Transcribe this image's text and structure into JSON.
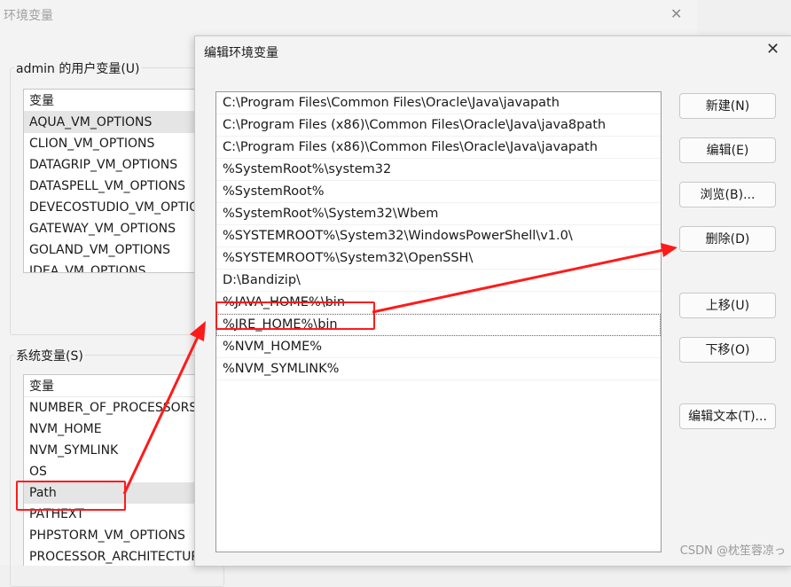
{
  "bg_window": {
    "title": "环境变量",
    "user_group": "admin 的用户变量(U)",
    "user_vars": {
      "header": "变量",
      "items": [
        "AQUA_VM_OPTIONS",
        "CLION_VM_OPTIONS",
        "DATAGRIP_VM_OPTIONS",
        "DATASPELL_VM_OPTIONS",
        "DEVECOSTUDIO_VM_OPTIONS",
        "GATEWAY_VM_OPTIONS",
        "GOLAND_VM_OPTIONS",
        "IDEA_VM_OPTIONS"
      ]
    },
    "system_group": "系统变量(S)",
    "system_vars": {
      "header": "变量",
      "items": [
        "NUMBER_OF_PROCESSORS",
        "NVM_HOME",
        "NVM_SYMLINK",
        "OS",
        "Path",
        "PATHEXT",
        "PHPSTORM_VM_OPTIONS",
        "PROCESSOR_ARCHITECTURE"
      ],
      "selected": "Path"
    }
  },
  "dialog": {
    "title": "编辑环境变量",
    "paths": [
      "C:\\Program Files\\Common Files\\Oracle\\Java\\javapath",
      "C:\\Program Files (x86)\\Common Files\\Oracle\\Java\\java8path",
      "C:\\Program Files (x86)\\Common Files\\Oracle\\Java\\javapath",
      "%SystemRoot%\\system32",
      "%SystemRoot%",
      "%SystemRoot%\\System32\\Wbem",
      "%SYSTEMROOT%\\System32\\WindowsPowerShell\\v1.0\\",
      "%SYSTEMROOT%\\System32\\OpenSSH\\",
      "D:\\Bandizip\\",
      "%JAVA_HOME%\\bin",
      "%JRE_HOME%\\bin",
      "%NVM_HOME%",
      "%NVM_SYMLINK%"
    ],
    "selected_path": "%JRE_HOME%\\bin",
    "buttons": {
      "new": "新建(N)",
      "edit": "编辑(E)",
      "browse": "浏览(B)...",
      "delete": "删除(D)",
      "move_up": "上移(U)",
      "move_down": "下移(O)",
      "edit_text": "编辑文本(T)..."
    }
  },
  "watermark": "CSDN @枕笙蓉凉っ",
  "colors": {
    "annotation": "#ff1a1a",
    "selection": "#e5e5e5"
  }
}
